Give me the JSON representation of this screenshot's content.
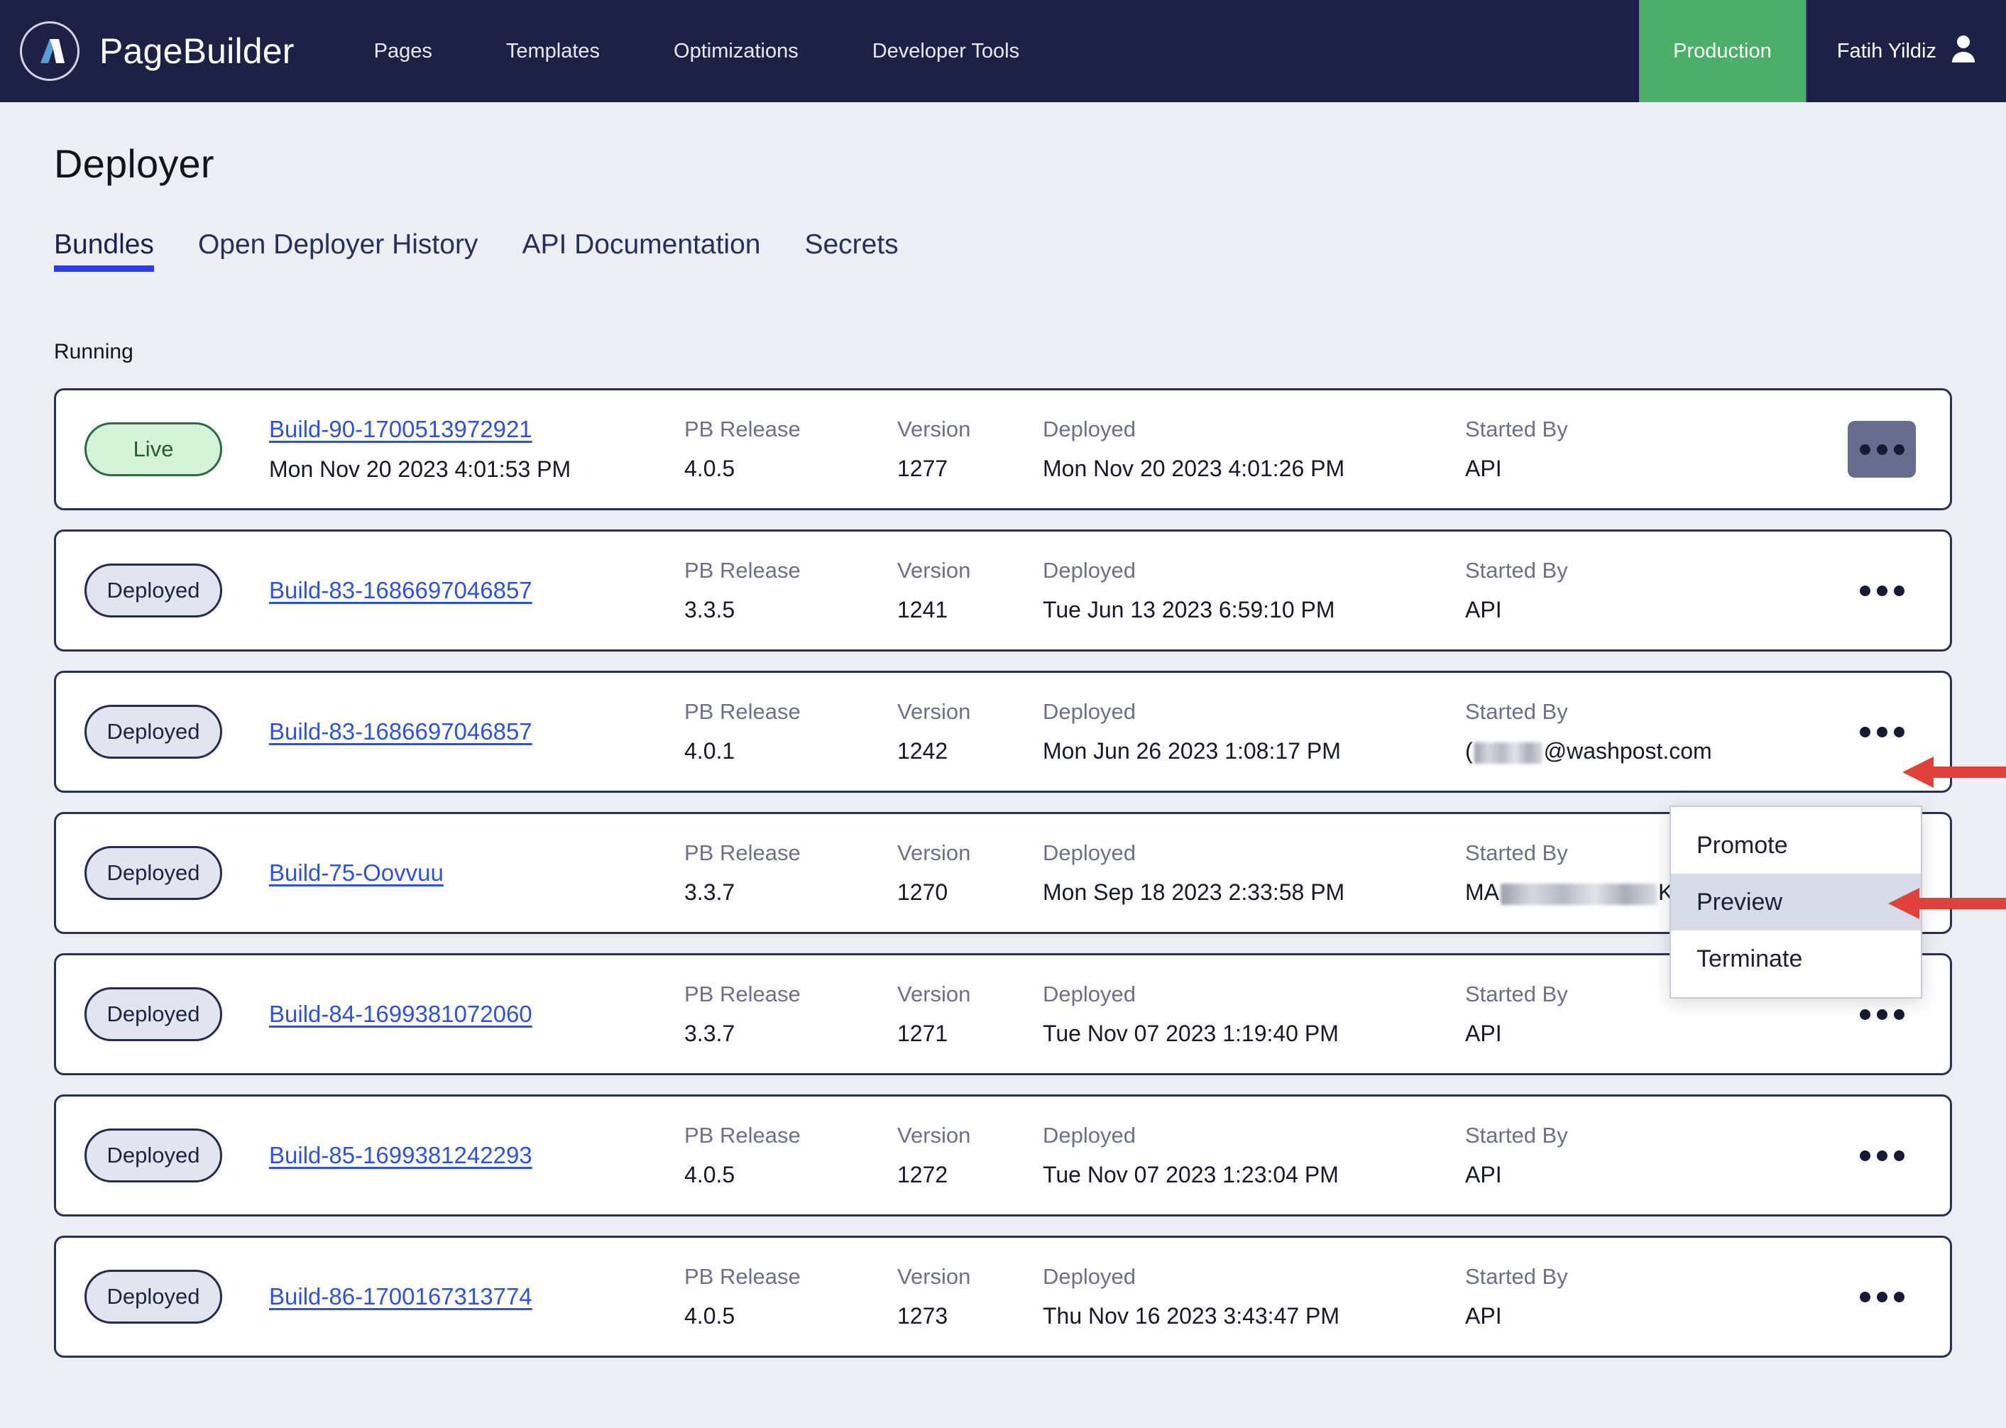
{
  "header": {
    "logo_icon": "pagebuilder-logo-icon",
    "brand": "PageBuilder",
    "nav": [
      {
        "label": "Pages"
      },
      {
        "label": "Templates"
      },
      {
        "label": "Optimizations"
      },
      {
        "label": "Developer Tools"
      }
    ],
    "environment": "Production",
    "environment_color": "#4caf69",
    "user_name": "Fatih Yildiz",
    "user_icon": "user-avatar-icon",
    "background_color": "#1d2145"
  },
  "main": {
    "page_title": "Deployer",
    "tabs": [
      {
        "label": "Bundles",
        "active": true
      },
      {
        "label": "Open Deployer History",
        "active": false
      },
      {
        "label": "API Documentation",
        "active": false
      },
      {
        "label": "Secrets",
        "active": false
      }
    ],
    "active_tab_underline_color": "#2b3ee0",
    "section_label": "Running",
    "column_headers": {
      "release": "PB Release",
      "version": "Version",
      "deployed": "Deployed",
      "started_by": "Started By"
    },
    "rows": [
      {
        "status": "Live",
        "status_type": "live",
        "build_name": "Build-90-1700513972921",
        "build_timestamp": "Mon Nov 20 2023 4:01:53 PM",
        "release": "4.0.5",
        "version": "1277",
        "deployed": "Mon Nov 20 2023 4:01:26 PM",
        "started_by": "API",
        "started_by_redacted": false,
        "kebab_active": true
      },
      {
        "status": "Deployed",
        "status_type": "deployed",
        "build_name": "Build-83-1686697046857",
        "build_timestamp": "",
        "release": "3.3.5",
        "version": "1241",
        "deployed": "Tue Jun 13 2023 6:59:10 PM",
        "started_by": "API",
        "started_by_redacted": false,
        "kebab_active": false
      },
      {
        "status": "Deployed",
        "status_type": "deployed",
        "build_name": "Build-83-1686697046857",
        "build_timestamp": "",
        "release": "4.0.1",
        "version": "1242",
        "deployed": "Mon Jun 26 2023 1:08:17 PM",
        "started_by_prefix": "(",
        "started_by_suffix": "@washpost.com",
        "started_by": "",
        "started_by_redacted": true,
        "kebab_active": false
      },
      {
        "status": "Deployed",
        "status_type": "deployed",
        "build_name": "Build-75-Oovvuu",
        "build_timestamp": "",
        "release": "3.3.7",
        "version": "1270",
        "deployed": "Mon Sep 18 2023 2:33:58 PM",
        "started_by_prefix": "MA",
        "started_by_suffix": "K(",
        "started_by": "",
        "started_by_redacted": true,
        "kebab_active": false
      },
      {
        "status": "Deployed",
        "status_type": "deployed",
        "build_name": "Build-84-1699381072060",
        "build_timestamp": "",
        "release": "3.3.7",
        "version": "1271",
        "deployed": "Tue Nov 07 2023 1:19:40 PM",
        "started_by": "API",
        "started_by_redacted": false,
        "kebab_active": false
      },
      {
        "status": "Deployed",
        "status_type": "deployed",
        "build_name": "Build-85-1699381242293",
        "build_timestamp": "",
        "release": "4.0.5",
        "version": "1272",
        "deployed": "Tue Nov 07 2023 1:23:04 PM",
        "started_by": "API",
        "started_by_redacted": false,
        "kebab_active": false
      },
      {
        "status": "Deployed",
        "status_type": "deployed",
        "build_name": "Build-86-1700167313774",
        "build_timestamp": "",
        "release": "4.0.5",
        "version": "1273",
        "deployed": "Thu Nov 16 2023 3:43:47 PM",
        "started_by": "API",
        "started_by_redacted": false,
        "kebab_active": false
      }
    ]
  },
  "context_menu": {
    "items": [
      {
        "label": "Promote",
        "highlighted": false
      },
      {
        "label": "Preview",
        "highlighted": true
      },
      {
        "label": "Terminate",
        "highlighted": false
      }
    ],
    "highlight_color": "#d7dbea"
  },
  "annotations": {
    "arrow_color": "#e0413a",
    "arrows": [
      {
        "target": "row-3-kebab-button"
      },
      {
        "target": "context-menu-item-preview"
      }
    ]
  }
}
